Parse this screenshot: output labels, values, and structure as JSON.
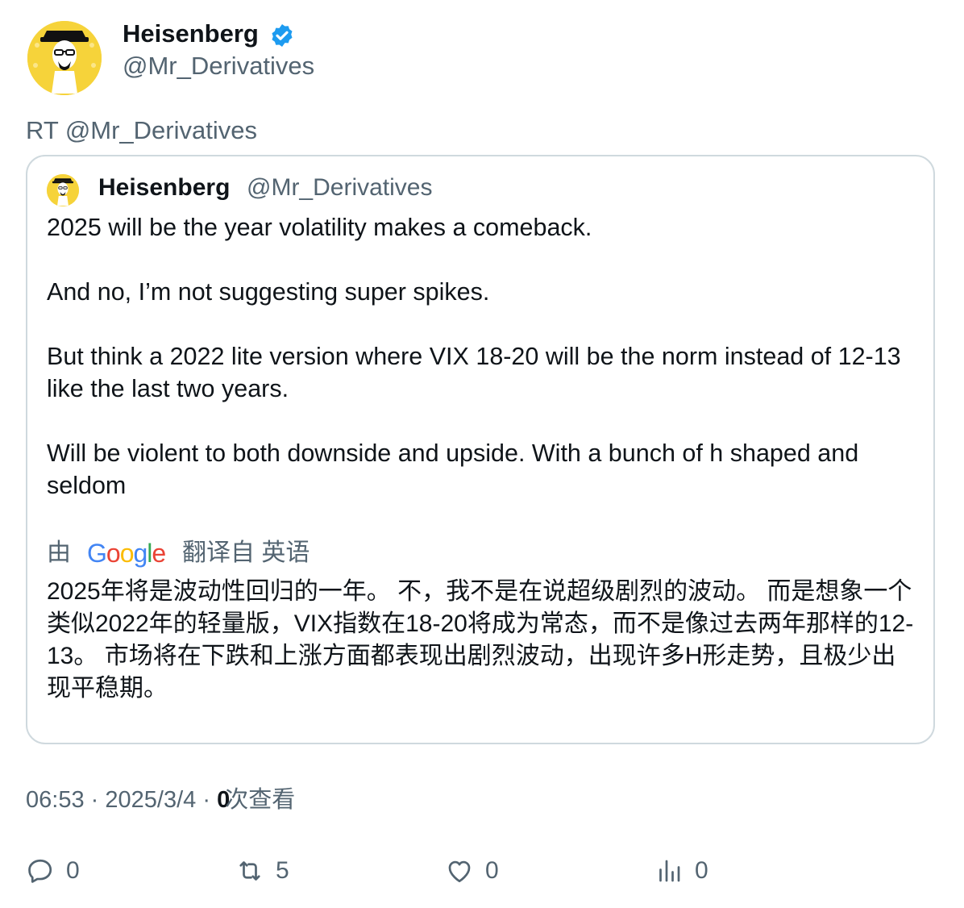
{
  "author": {
    "name": "Heisenberg",
    "handle": "@Mr_Derivatives"
  },
  "retweet_label": "RT @Mr_Derivatives",
  "quoted": {
    "name": "Heisenberg",
    "handle": "@Mr_Derivatives",
    "paragraphs": [
      "2025 will be the year volatility makes a comeback.",
      "And no, I’m not suggesting super spikes.",
      "But think a 2022 lite version where VIX 18-20 will be the norm instead of 12-13 like the last two years.",
      "Will be violent to both downside and upside. With a bunch of h shaped and seldom"
    ],
    "translation_by": "由",
    "translation_brand": "Google",
    "translation_from": "翻译自 英语",
    "translation_text": "2025年将是波动性回归的一年。 不，我不是在说超级剧烈的波动。 而是想象一个类似2022年的轻量版，VIX指数在18-20将成为常态，而不是像过去两年那样的12-13。 市场将在下跌和上涨方面都表现出剧烈波动，出现许多H形走势，且极少出现平稳期。"
  },
  "meta": {
    "time": "06:53",
    "separator": "·",
    "date": "2025/3/4",
    "views_count": "0",
    "views_label": "次查看"
  },
  "actions": {
    "reply": {
      "icon": "reply-icon",
      "count": "0"
    },
    "retweet": {
      "icon": "retweet-icon",
      "count": "5"
    },
    "like": {
      "icon": "heart-icon",
      "count": "0"
    },
    "views": {
      "icon": "analytics-icon",
      "count": "0"
    }
  },
  "colors": {
    "text_primary": "#0f1419",
    "text_secondary": "#536471",
    "border": "#cfd9de",
    "verified_blue": "#1d9bf0",
    "avatar_yellow": "#f6d33a"
  }
}
